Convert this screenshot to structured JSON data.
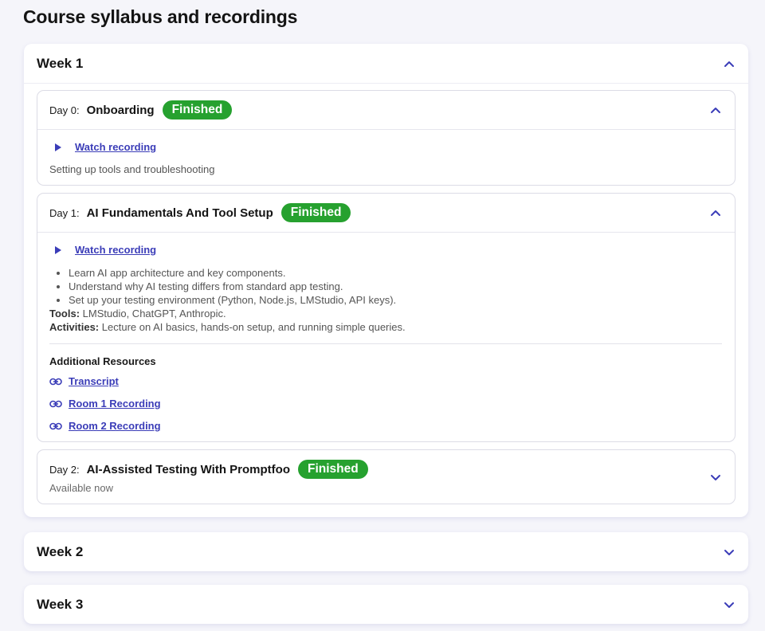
{
  "page": {
    "title": "Course syllabus and recordings"
  },
  "colors": {
    "accent": "#3b3db8",
    "badge": "#26a12f",
    "text_muted": "#6a6a6a"
  },
  "weeks": [
    {
      "title": "Week 1",
      "expanded": true,
      "days": [
        {
          "num": "Day 0:",
          "title": "Onboarding",
          "badge": "Finished",
          "expanded": true,
          "watch_label": "Watch recording",
          "description": "Setting up tools and troubleshooting"
        },
        {
          "num": "Day 1:",
          "title": "AI Fundamentals And Tool Setup",
          "badge": "Finished",
          "expanded": true,
          "watch_label": "Watch recording",
          "bullets": [
            "Learn AI app architecture and key components.",
            "Understand why AI testing differs from standard app testing.",
            "Set up your testing environment (Python, Node.js, LMStudio, API keys)."
          ],
          "tools_label": "Tools:",
          "tools_value": "LMStudio, ChatGPT, Anthropic.",
          "activities_label": "Activities:",
          "activities_value": "Lecture on AI basics, hands-on setup, and running simple queries.",
          "resources_title": "Additional Resources",
          "resources": [
            "Transcript",
            "Room 1 Recording",
            "Room 2 Recording"
          ]
        },
        {
          "num": "Day 2:",
          "title": "AI-Assisted Testing With Promptfoo",
          "badge": "Finished",
          "expanded": false,
          "subtitle": "Available now"
        }
      ]
    },
    {
      "title": "Week 2",
      "expanded": false
    },
    {
      "title": "Week 3",
      "expanded": false
    }
  ],
  "icons": {
    "expand": "chevron-up-icon",
    "collapse": "chevron-down-icon",
    "play": "play-icon",
    "link": "link-icon"
  }
}
